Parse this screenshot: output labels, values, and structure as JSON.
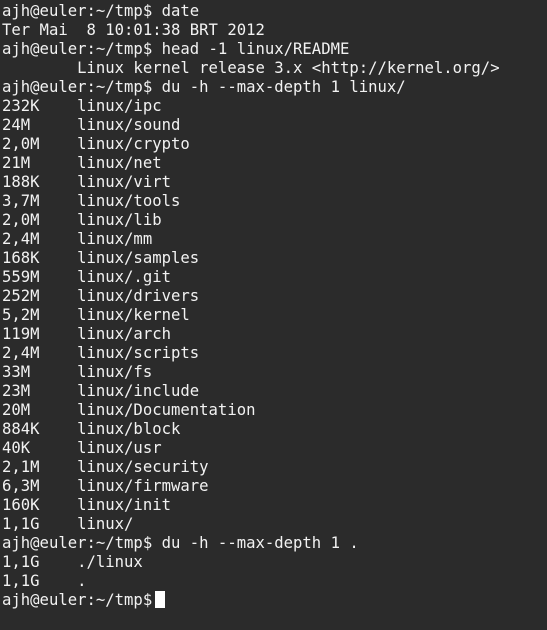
{
  "lines": [
    "ajh@euler:~/tmp$ date",
    "Ter Mai  8 10:01:38 BRT 2012",
    "ajh@euler:~/tmp$ head -1 linux/README",
    "        Linux kernel release 3.x <http://kernel.org/>",
    "ajh@euler:~/tmp$ du -h --max-depth 1 linux/",
    "232K    linux/ipc",
    "24M     linux/sound",
    "2,0M    linux/crypto",
    "21M     linux/net",
    "188K    linux/virt",
    "3,7M    linux/tools",
    "2,0M    linux/lib",
    "2,4M    linux/mm",
    "168K    linux/samples",
    "559M    linux/.git",
    "252M    linux/drivers",
    "5,2M    linux/kernel",
    "119M    linux/arch",
    "2,4M    linux/scripts",
    "33M     linux/fs",
    "23M     linux/include",
    "20M     linux/Documentation",
    "884K    linux/block",
    "40K     linux/usr",
    "2,1M    linux/security",
    "6,3M    linux/firmware",
    "160K    linux/init",
    "1,1G    linux/",
    "ajh@euler:~/tmp$ du -h --max-depth 1 .",
    "1,1G    ./linux",
    "1,1G    ."
  ],
  "prompt": "ajh@euler:~/tmp$",
  "colors": {
    "background": "#2b2b2b",
    "foreground": "#f2f2f2",
    "cursor": "#ffffff"
  }
}
